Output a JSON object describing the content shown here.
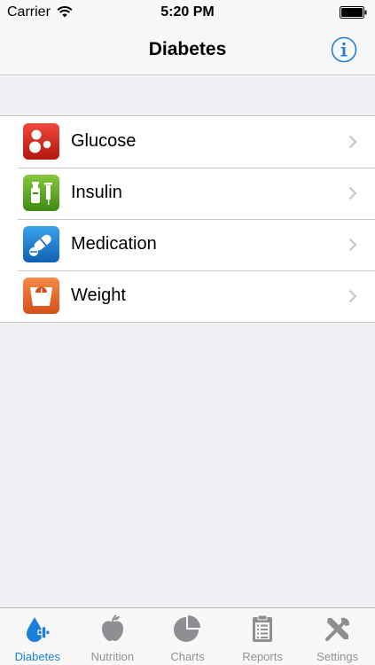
{
  "status": {
    "carrier": "Carrier",
    "time": "5:20 PM"
  },
  "nav": {
    "title": "Diabetes",
    "info_icon": "info-icon"
  },
  "menu": {
    "items": [
      {
        "label": "Glucose",
        "icon": "glucose-drops-icon",
        "color": "#d9261c"
      },
      {
        "label": "Insulin",
        "icon": "insulin-syringe-icon",
        "color": "#5fa524"
      },
      {
        "label": "Medication",
        "icon": "pills-icon",
        "color": "#1d7fd1"
      },
      {
        "label": "Weight",
        "icon": "scale-icon",
        "color": "#e66a2c"
      }
    ]
  },
  "tabs": [
    {
      "label": "Diabetes",
      "icon": "diabetes-drop-icon",
      "active": true
    },
    {
      "label": "Nutrition",
      "icon": "apple-icon",
      "active": false
    },
    {
      "label": "Charts",
      "icon": "pie-chart-icon",
      "active": false
    },
    {
      "label": "Reports",
      "icon": "clipboard-icon",
      "active": false
    },
    {
      "label": "Settings",
      "icon": "tools-icon",
      "active": false
    }
  ],
  "colors": {
    "accent": "#1a7fd8",
    "inactive_tab": "#929292",
    "background": "#efeff4"
  }
}
